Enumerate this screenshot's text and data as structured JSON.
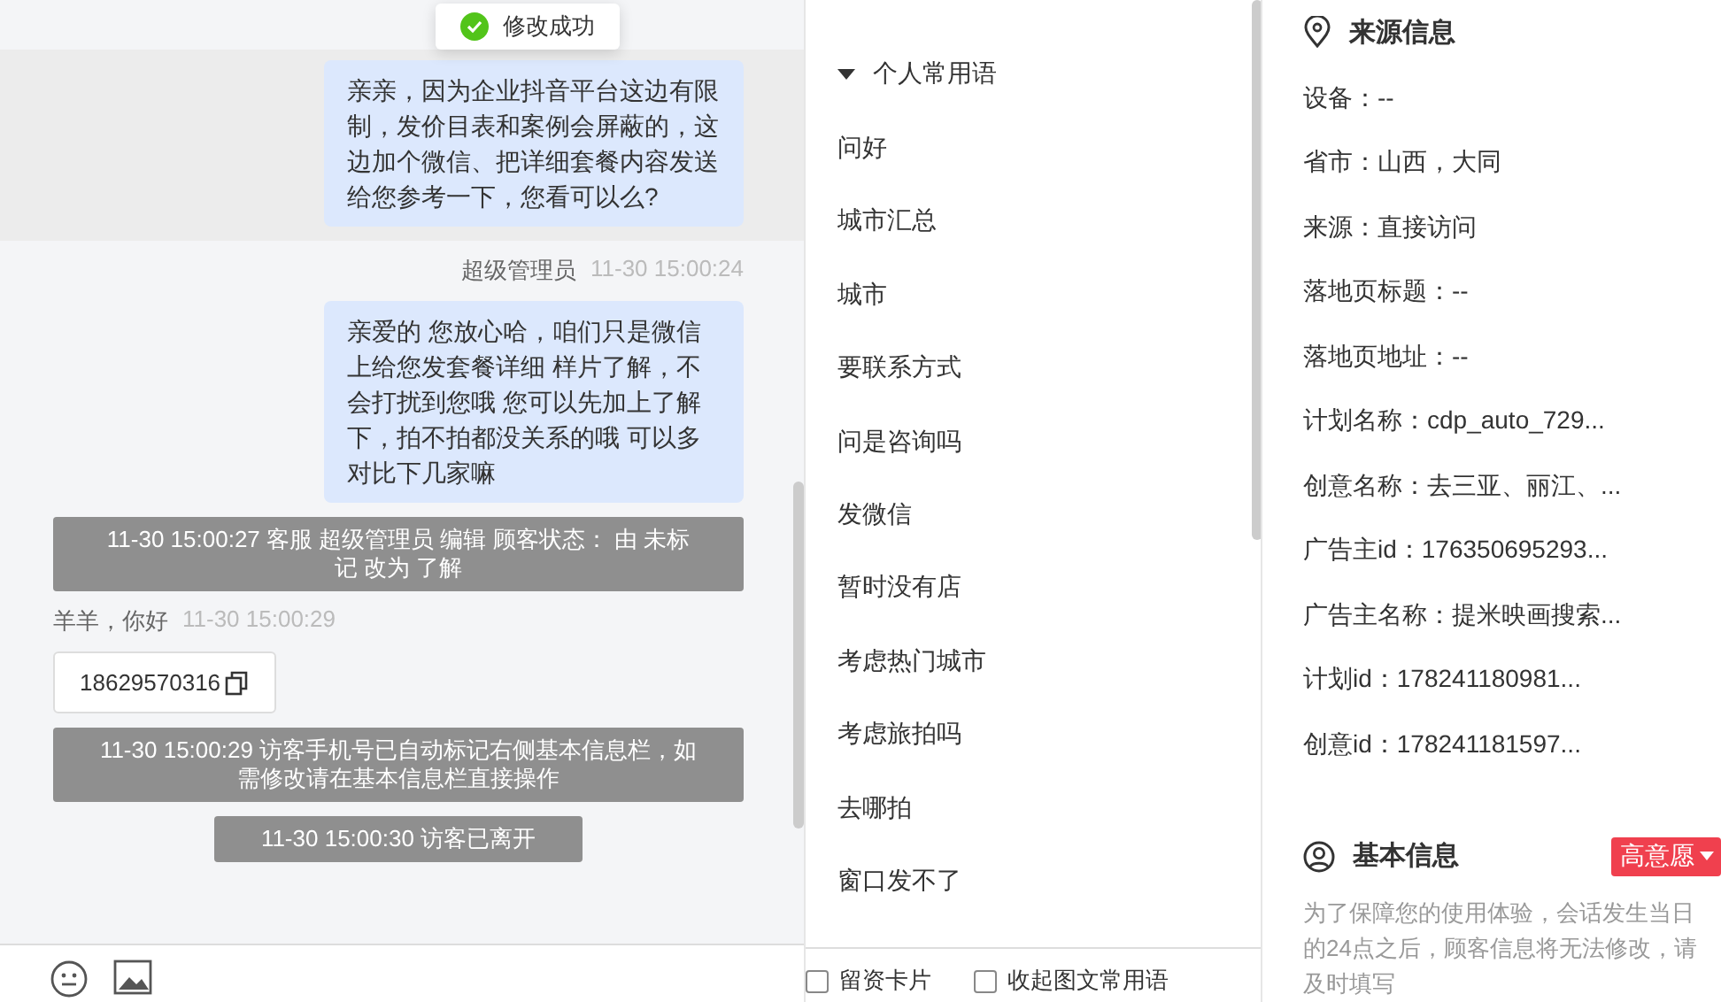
{
  "toast": {
    "text": "修改成功"
  },
  "chat": {
    "messages": [
      {
        "kind": "agent",
        "highlighted": true,
        "text": "亲亲，因为企业抖音平台这边有限制，发价目表和案例会屏蔽的，这边加个微信、把详细套餐内容发送给您参考一下，您看可以么?"
      },
      {
        "kind": "agent",
        "highlighted": false,
        "sender": "超级管理员",
        "time": "11-30 15:00:24",
        "text": "亲爱的 您放心哈，咱们只是微信上给您发套餐详细 样片了解，不会打扰到您哦 您可以先加上了解下，拍不拍都没关系的哦 可以多对比下几家嘛"
      },
      {
        "kind": "system",
        "text": "11-30 15:00:27 客服 超级管理员 编辑 顾客状态： 由 未标记 改为 了解"
      },
      {
        "kind": "visitor",
        "sender": "羊羊，你好",
        "time": "11-30 15:00:29",
        "text": "18629570316"
      },
      {
        "kind": "system",
        "text": "11-30 15:00:29 访客手机号已自动标记右侧基本信息栏，如需修改请在基本信息栏直接操作"
      },
      {
        "kind": "system",
        "text": "11-30 15:00:30 访客已离开"
      }
    ]
  },
  "phrases": {
    "title": "个人常用语",
    "expanded": true,
    "items": [
      "问好",
      "城市汇总",
      "城市",
      "要联系方式",
      "问是咨询吗",
      "发微信",
      "暂时没有店",
      "考虑热门城市",
      "考虑旅拍吗",
      "去哪拍",
      "窗口发不了"
    ],
    "options": [
      {
        "label": "留资卡片",
        "checked": false
      },
      {
        "label": "收起图文常用语",
        "checked": false
      }
    ]
  },
  "source_info": {
    "title": "来源信息",
    "fields": [
      "设备：--",
      "省市：山西，大同",
      "来源：直接访问",
      "落地页标题：--",
      "落地页地址：--",
      "计划名称：cdp_auto_729...",
      "创意名称：去三亚、丽江、...",
      "广告主id：176350695293...",
      "广告主名称：提米映画搜索...",
      "计划id：178241180981...",
      "创意id：178241181597..."
    ]
  },
  "basic_info": {
    "title": "基本信息",
    "intent": "高意愿",
    "note": "为了保障您的使用体验，会话发生当日的24点之后，顾客信息将无法修改，请及时填写"
  }
}
